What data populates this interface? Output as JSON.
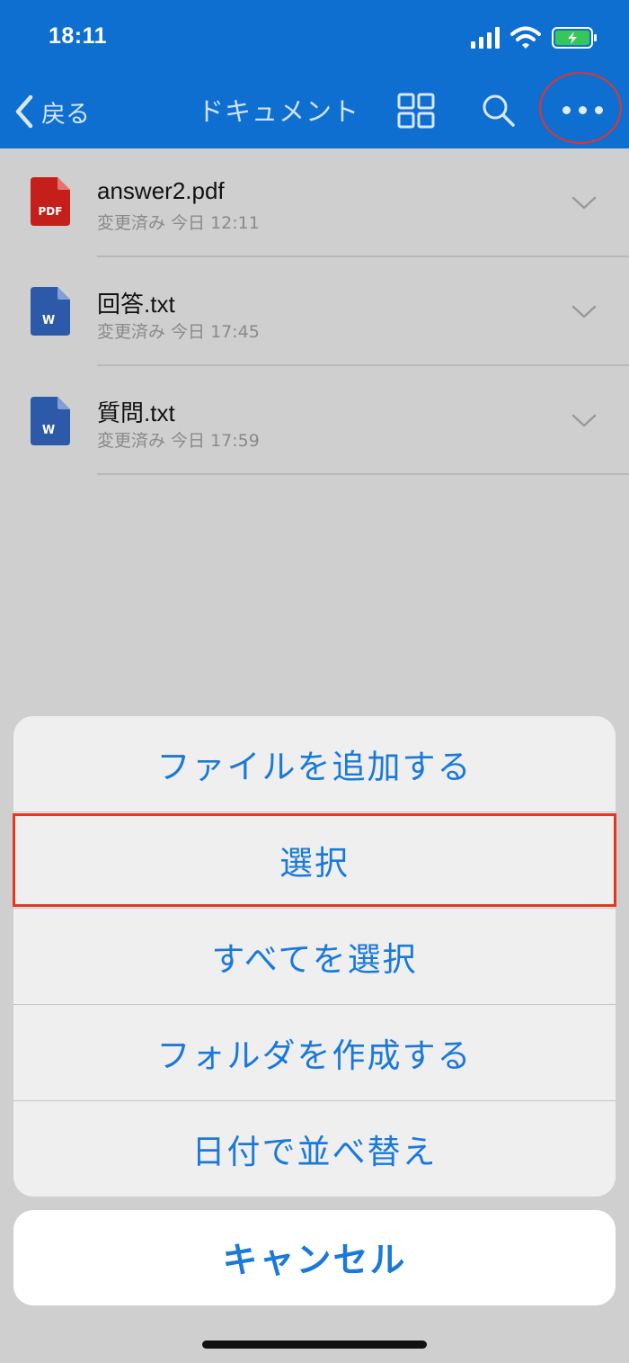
{
  "status_bar": {
    "time": "18:11",
    "icons": [
      "signal-icon",
      "wifi-icon",
      "battery-charging-icon"
    ]
  },
  "nav": {
    "back_label": "戻る",
    "title": "ドキュメント",
    "icons": [
      "grid-view-icon",
      "search-icon",
      "more-icon"
    ]
  },
  "files": [
    {
      "name": "answer2.pdf",
      "meta": "変更済み 今日 12:11",
      "type": "pdf",
      "icon_label": "PDF"
    },
    {
      "name": "回答.txt",
      "meta": "変更済み 今日 17:45",
      "type": "word",
      "icon_label": "W"
    },
    {
      "name": "質問.txt",
      "meta": "変更済み 今日 17:59",
      "type": "word",
      "icon_label": "W"
    }
  ],
  "action_sheet": {
    "items": [
      {
        "label": "ファイルを追加する"
      },
      {
        "label": "選択",
        "highlighted": true
      },
      {
        "label": "すべてを選択"
      },
      {
        "label": "フォルダを作成する"
      },
      {
        "label": "日付で並べ替え"
      }
    ],
    "cancel_label": "キャンセル"
  },
  "colors": {
    "header": "#0f6fd1",
    "action_text": "#1a79d9",
    "highlight": "#e8351e",
    "pdf_icon": "#c41f1a",
    "word_icon": "#2d5aa8"
  }
}
